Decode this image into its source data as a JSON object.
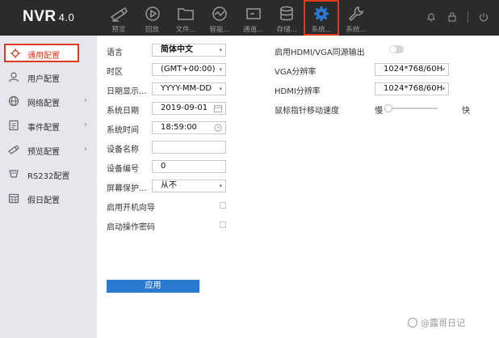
{
  "header": {
    "logo": "NVR",
    "version": "4.0",
    "nav": [
      {
        "label": "预览",
        "icon": "camera-icon"
      },
      {
        "label": "回放",
        "icon": "play-icon"
      },
      {
        "label": "文件...",
        "icon": "folder-icon"
      },
      {
        "label": "智能...",
        "icon": "analytics-icon"
      },
      {
        "label": "通道...",
        "icon": "channel-icon"
      },
      {
        "label": "存储...",
        "icon": "storage-icon"
      },
      {
        "label": "系统...",
        "icon": "gear-icon",
        "active": true
      },
      {
        "label": "系统...",
        "icon": "wrench-icon"
      }
    ],
    "right_icons": [
      "bell-icon",
      "lock-icon",
      "power-icon"
    ]
  },
  "sidebar": {
    "items": [
      {
        "label": "通用配置",
        "icon": "gear-icon",
        "active": true,
        "has_children": false
      },
      {
        "label": "用户配置",
        "icon": "user-icon",
        "has_children": false
      },
      {
        "label": "网络配置",
        "icon": "globe-icon",
        "has_children": true
      },
      {
        "label": "事件配置",
        "icon": "event-icon",
        "has_children": true
      },
      {
        "label": "预览配置",
        "icon": "camera-icon",
        "has_children": true
      },
      {
        "label": "RS232配置",
        "icon": "port-icon",
        "has_children": false
      },
      {
        "label": "假日配置",
        "icon": "calendar-icon",
        "has_children": false
      }
    ],
    "chevron": "›"
  },
  "form": {
    "language": {
      "label": "语言",
      "value": "简体中文"
    },
    "timezone": {
      "label": "时区",
      "value": "(GMT+00:00)"
    },
    "date_format": {
      "label": "日期显示...",
      "value": "YYYY-MM-DD"
    },
    "system_date": {
      "label": "系统日期",
      "value": "2019-09-01"
    },
    "system_time": {
      "label": "系统时间",
      "value": "18:59:00"
    },
    "device_name": {
      "label": "设备名称",
      "value": ""
    },
    "device_no": {
      "label": "设备编号",
      "value": "0"
    },
    "screensaver": {
      "label": "屏幕保护...",
      "value": "从不"
    },
    "startup_wizard": {
      "label": "启用开机向导",
      "checked": false
    },
    "startup_password": {
      "label": "启动操作密码",
      "checked": false
    },
    "hdmi_vga_sync": {
      "label": "启用HDMI/VGA同源输出",
      "on": false
    },
    "vga_resolution": {
      "label": "VGA分辨率",
      "value": "1024*768/60H"
    },
    "hdmi_resolution": {
      "label": "HDMI分辨率",
      "value": "1024*768/60H"
    },
    "mouse_speed": {
      "label": "鼠标指针移动速度",
      "slow": "慢",
      "fast": "快",
      "level": 0.05
    },
    "apply_label": "应用",
    "dropdown_arrow": "▾"
  },
  "watermark": {
    "text": "@露哥日记"
  },
  "colors": {
    "accent": "#2a7ad4",
    "highlight": "#e03a1e",
    "topbar": "#2b2b2b",
    "sidebar": "#e6e6ec"
  }
}
